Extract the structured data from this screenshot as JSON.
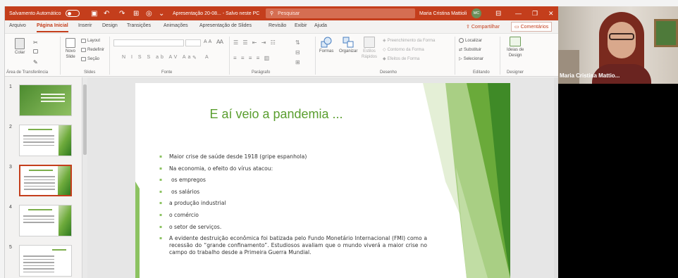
{
  "titlebar": {
    "autosave_label": "Salvamento Automático",
    "doc_name": "Apresentação 20-08... - Salvo neste PC",
    "search_placeholder": "Pesquisar",
    "user_name": "Maria Cristina Mattioli",
    "user_initials": "MC"
  },
  "tabs": [
    "Arquivo",
    "Página Inicial",
    "Inserir",
    "Design",
    "Transições",
    "Animações",
    "Apresentação de Slides",
    "Revisão",
    "Exibir",
    "Ajuda"
  ],
  "tab_actions": {
    "share": "Compartilhar",
    "comments": "Comentários"
  },
  "ribbon": {
    "clipboard": {
      "paste": "Colar",
      "group": "Área de Transferência"
    },
    "slides": {
      "new_slide": "Novo",
      "new_slide_2": "Slide",
      "layout": "Layout",
      "reset": "Redefinir",
      "section": "Seção",
      "group": "Slides"
    },
    "font": {
      "group": "Fonte"
    },
    "paragraph": {
      "group": "Parágrafo"
    },
    "drawing": {
      "shapes": "Formas",
      "arrange": "Organizar",
      "styles": "Estilos",
      "styles_2": "Rápidos",
      "fill": "Preenchimento da Forma",
      "outline": "Contorno da Forma",
      "effects": "Efeitos de Forma",
      "group": "Desenho"
    },
    "editing": {
      "find": "Localizar",
      "replace": "Substituir",
      "select": "Selecionar",
      "group": "Editando"
    },
    "designer": {
      "ideas": "Ideias de",
      "ideas_2": "Design",
      "group": "Designer"
    }
  },
  "thumbnails": [
    {
      "number": "1"
    },
    {
      "number": "2"
    },
    {
      "number": "3"
    },
    {
      "number": "4"
    },
    {
      "number": "5"
    }
  ],
  "slide": {
    "title": "E aí veio a pandemia ...",
    "bullets": [
      "Maior crise de saúde desde 1918 (gripe espanhola)",
      "Na economia, o efeito do vírus atacou:",
      "os empregos",
      "os salários",
      "a produção industrial",
      "o comércio",
      "o setor de serviços.",
      "A evidente destruição econômica foi batizada pelo Fundo Monetário Internacional (FMI) como a recessão do “grande confinamento”. Estudiosos avaliam que o mundo viverá a maior crise no campo do trabalho desde a Primeira Guerra Mundial."
    ]
  },
  "video": {
    "participant_name": "Maria Cristina Mattio..."
  },
  "colors": {
    "accent": "#c43e1c",
    "slide_green": "#5a9e2f"
  }
}
